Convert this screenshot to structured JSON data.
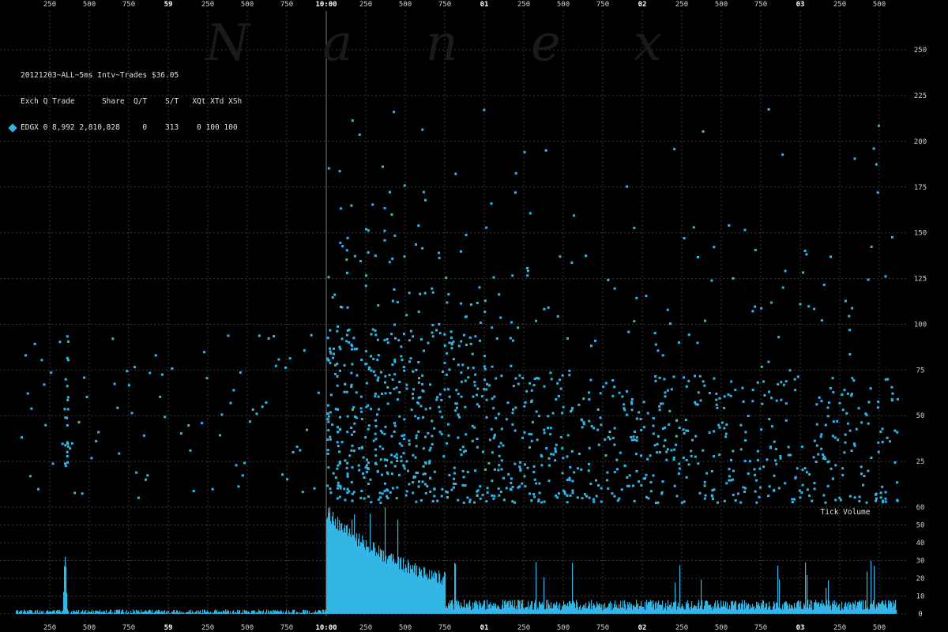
{
  "watermark": {
    "letters": [
      "N",
      "a",
      "n",
      "e",
      "x"
    ]
  },
  "header": {
    "title": "20121203~ALL~5ms Intv~Trades $36.05",
    "columns": "Exch Q Trade      Share  Q/T    S/T   XQt XTd XSh",
    "row": "EDGX 0 8,992 2,810,828     0    313    0 100 100"
  },
  "colors": {
    "background": "#000000",
    "series": "#33b5e5",
    "grid": "#4a4a4a",
    "text": "#d8d8d8"
  },
  "chart_data": [
    {
      "type": "scatter",
      "title": "",
      "series": [
        {
          "name": "EDGX",
          "color": "#33b5e5"
        }
      ],
      "x_tick_labels": [
        "250",
        "500",
        "750",
        "59",
        "250",
        "500",
        "750",
        "10:00",
        "250",
        "500",
        "750",
        "01",
        "250",
        "500",
        "750",
        "02",
        "250",
        "500",
        "750",
        "03",
        "250",
        "500"
      ],
      "x_major_labels": [
        "59",
        "10:00",
        "01",
        "02",
        "03"
      ],
      "y_ticks": [
        25,
        50,
        75,
        100,
        125,
        150,
        175,
        200,
        225,
        250
      ],
      "ylim": [
        0,
        260
      ],
      "density_profile": {
        "before_open": "sparse",
        "spike_at": "500 (minute 58)",
        "open_at": "10:00",
        "after_open": "dense cluster 0-100, decaying",
        "late": "moderate 0-75"
      },
      "grid": true
    },
    {
      "type": "bar",
      "title": "Tick Volume",
      "y_ticks": [
        0,
        10,
        20,
        30,
        40,
        50,
        60
      ],
      "ylim": [
        0,
        60
      ],
      "peaks": [
        {
          "x": "500 (minute 58)",
          "value": 32
        },
        {
          "x": "10:00",
          "value": 57
        },
        {
          "x": "750 (minute 00)",
          "value": 40
        },
        {
          "x": "750 (minute 01)",
          "value": 27
        }
      ],
      "grid": true
    }
  ]
}
